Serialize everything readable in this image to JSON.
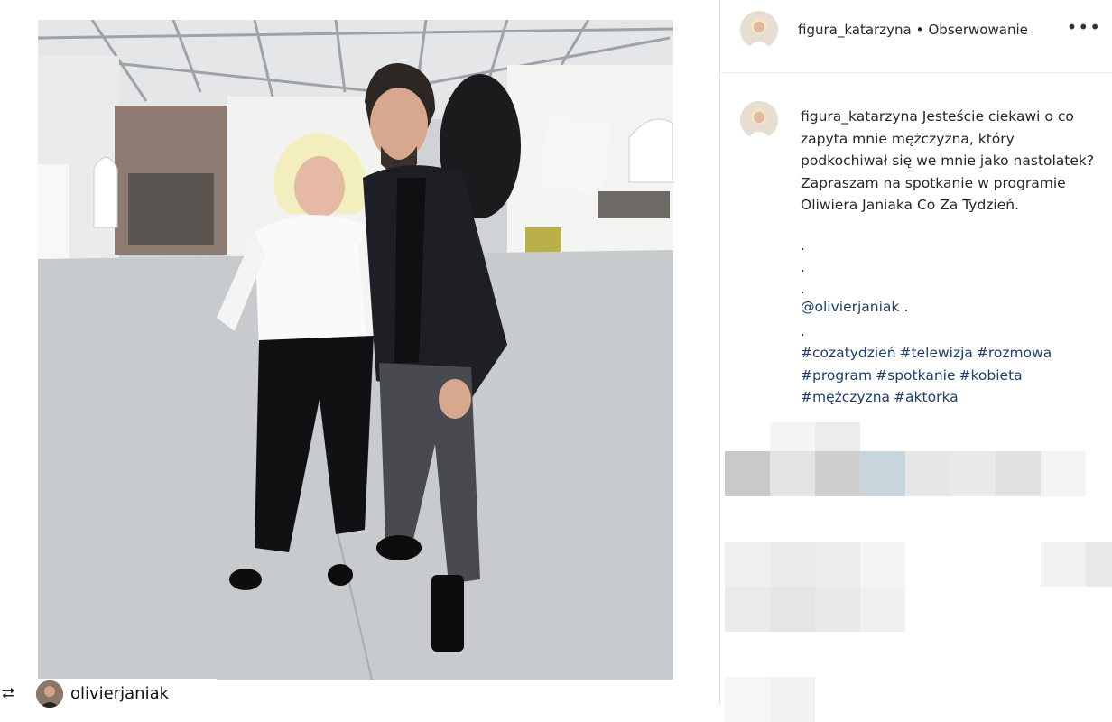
{
  "post": {
    "username": "figura_katarzyna",
    "follow_label": "Obserwowanie",
    "more_icon": "more-icon",
    "more_glyph": "•••"
  },
  "caption": {
    "username": "figura_katarzyna",
    "text": "Jesteście ciekawi o co zapyta mnie mężczyzna, który podkochiwał się we mnie jako nastolatek? Zapraszam na spotkanie w programie Oliwiera Janiaka Co Za Tydzień.",
    "dots": [
      ".",
      ".",
      "."
    ],
    "mention": "@olivierjaniak",
    "mention_tail": " .",
    "dot_after": ".",
    "hashtags": [
      "#cozatydzień",
      "#telewizja",
      "#rozmowa",
      "#program",
      "#spotkanie",
      "#kobieta",
      "#mężczyzna",
      "#aktorka"
    ]
  },
  "repost": {
    "icon": "repost-icon",
    "glyph": "⮂",
    "username": "olivierjaniak"
  },
  "colors": {
    "link": "#1f3f6d",
    "text": "#262626",
    "divider": "#e3e3e3"
  }
}
